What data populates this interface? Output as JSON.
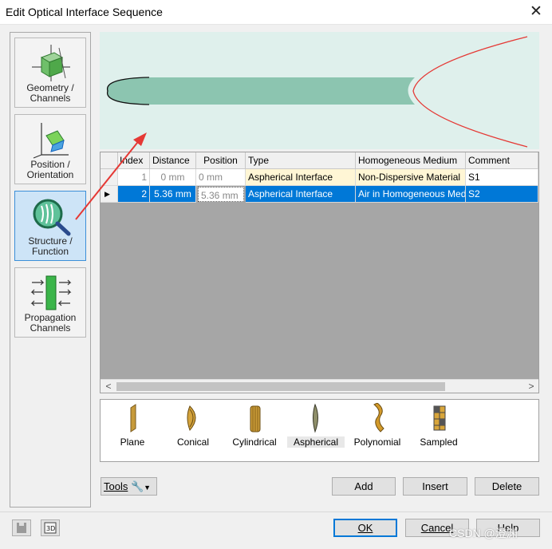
{
  "window": {
    "title": "Edit Optical Interface Sequence",
    "close_glyph": "✕"
  },
  "nav": {
    "items": [
      {
        "line1": "Geometry /",
        "line2": "Channels",
        "icon": "geometry-cube-icon"
      },
      {
        "line1": "Position /",
        "line2": "Orientation",
        "icon": "position-axes-icon"
      },
      {
        "line1": "Structure /",
        "line2": "Function",
        "icon": "structure-magnifier-icon",
        "selected": true
      },
      {
        "line1": "Propagation",
        "line2": "Channels",
        "icon": "propagation-arrows-icon"
      }
    ]
  },
  "table": {
    "headers": {
      "index": "Index",
      "distance": "Distance",
      "position": "Position",
      "type": "Type",
      "medium": "Homogeneous Medium",
      "comment": "Comment"
    },
    "rows": [
      {
        "index": "1",
        "distance": "0 mm",
        "position": "0 mm",
        "type": "Aspherical Interface",
        "medium": "Non-Dispersive Material",
        "comment": "S1"
      },
      {
        "index": "2",
        "distance": "5.36 mm",
        "position": "5.36 mm",
        "type": "Aspherical Interface",
        "medium": "Air in Homogeneous Medium",
        "comment": "S2"
      }
    ],
    "row_marker": "▶",
    "scroll_left": "<",
    "scroll_right": ">"
  },
  "tools": [
    {
      "label": "Plane",
      "icon": "plane-surface-icon"
    },
    {
      "label": "Conical",
      "icon": "conical-surface-icon"
    },
    {
      "label": "Cylindrical",
      "icon": "cylindrical-surface-icon"
    },
    {
      "label": "Aspherical",
      "icon": "aspherical-surface-icon"
    },
    {
      "label": "Polynomial",
      "icon": "polynomial-surface-icon"
    },
    {
      "label": "Sampled",
      "icon": "sampled-surface-icon"
    }
  ],
  "actions": {
    "tools_label": "Tools",
    "add": "Add",
    "insert": "Insert",
    "delete": "Delete"
  },
  "footer": {
    "ok": "OK",
    "cancel": "Cancel",
    "help": "Help"
  },
  "watermark": "CSDN @澄渊",
  "colors": {
    "selection": "#0078d7",
    "accent_arrow": "#e53935",
    "preview_bg": "#dff0ec",
    "element_fill": "#8cc5b0",
    "grid_bg": "#a6a6a6"
  }
}
